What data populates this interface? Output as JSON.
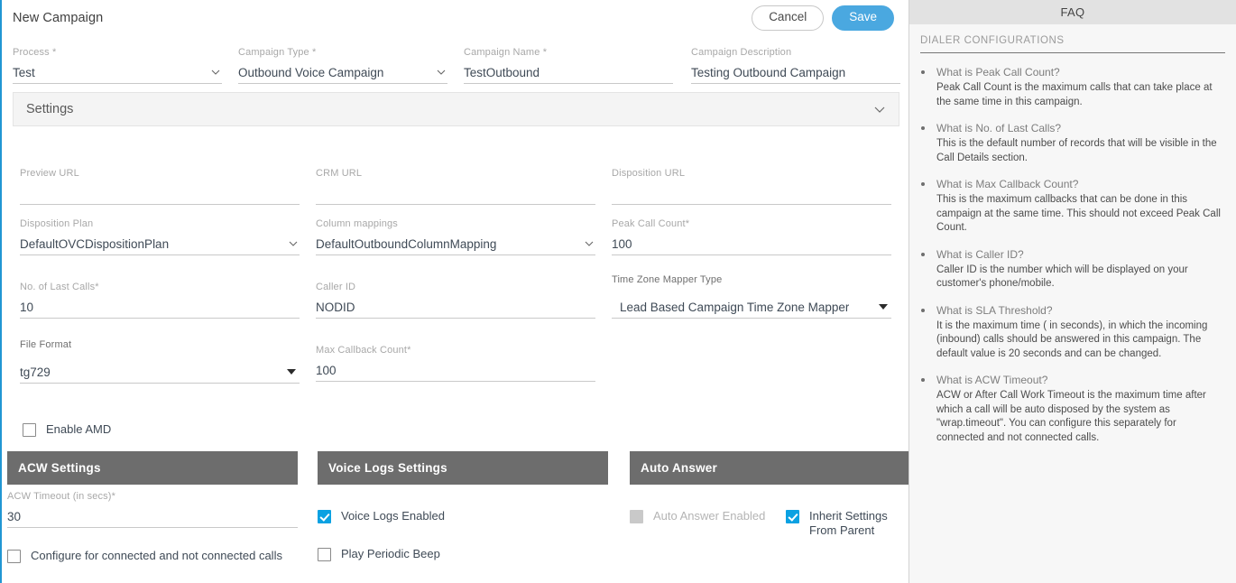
{
  "header": {
    "title": "New Campaign",
    "cancel_label": "Cancel",
    "save_label": "Save",
    "save_color": "#4aa8e0"
  },
  "top_fields": [
    {
      "label": "Process *",
      "value": "Test",
      "control": "select"
    },
    {
      "label": "Campaign Type *",
      "value": "Outbound Voice Campaign",
      "control": "select"
    },
    {
      "label": "Campaign Name *",
      "value": "TestOutbound",
      "control": "text"
    },
    {
      "label": "Campaign Description",
      "value": "Testing Outbound Campaign",
      "control": "text"
    }
  ],
  "settings": {
    "title": "Settings",
    "fields": {
      "preview_url": {
        "label": "Preview URL",
        "value": ""
      },
      "crm_url": {
        "label": "CRM URL",
        "value": ""
      },
      "disposition_url": {
        "label": "Disposition URL",
        "value": ""
      },
      "disposition_plan": {
        "label": "Disposition Plan",
        "value": "DefaultOVCDispositionPlan"
      },
      "column_mappings": {
        "label": "Column mappings",
        "value": "DefaultOutboundColumnMapping"
      },
      "peak_call_count": {
        "label": "Peak Call Count*",
        "value": "100"
      },
      "no_of_last_calls": {
        "label": "No. of Last Calls*",
        "value": "10"
      },
      "caller_id": {
        "label": "Caller ID",
        "value": "NODID"
      },
      "time_zone_mapper_type": {
        "label": "Time Zone Mapper Type",
        "value": "Lead Based Campaign Time Zone Mapper"
      },
      "file_format": {
        "label": "File Format",
        "value": "tg729"
      },
      "max_callback_count": {
        "label": "Max Callback Count*",
        "value": "100"
      }
    },
    "enable_amd": {
      "label": "Enable AMD",
      "checked": false
    }
  },
  "acw": {
    "title": "ACW Settings",
    "timeout": {
      "label": "ACW Timeout (in secs)*",
      "value": "30"
    },
    "configure_connected": {
      "label": "Configure for connected and not connected calls",
      "checked": false
    }
  },
  "voice_logs": {
    "title": "Voice Logs Settings",
    "voice_logs_enabled": {
      "label": "Voice Logs Enabled",
      "checked": true
    },
    "play_periodic_beep": {
      "label": "Play Periodic Beep",
      "checked": false
    }
  },
  "auto_answer": {
    "title": "Auto Answer",
    "auto_answer_enabled": {
      "label": "Auto Answer Enabled",
      "checked": false,
      "disabled": true
    },
    "inherit_from_parent": {
      "label": "Inherit Settings From Parent",
      "checked": true
    }
  },
  "faq": {
    "title": "FAQ",
    "section_title": "DIALER CONFIGURATIONS",
    "items": [
      {
        "question": "What is Peak Call Count?",
        "answer": "Peak Call Count is the maximum calls that can take place at the same time in this campaign."
      },
      {
        "question": "What is No. of Last Calls?",
        "answer": "This is the default number of records that will be visible in the Call Details section."
      },
      {
        "question": "What is Max Callback Count?",
        "answer": "This is the maximum callbacks that can be done in this campaign at the same time. This should not exceed Peak Call Count."
      },
      {
        "question": "What is Caller ID?",
        "answer": "Caller ID is the number which will be displayed on your customer's phone/mobile."
      },
      {
        "question": "What is SLA Threshold?",
        "answer": "It is the maximum time ( in seconds), in which the incoming (inbound) calls should be answered in this campaign. The default value is 20 seconds and can be changed."
      },
      {
        "question": "What is ACW Timeout?",
        "answer": "ACW or After Call Work Timeout is the maximum time after which a call will be auto disposed by the system as \"wrap.timeout\". You can configure this separately for connected and not connected calls."
      }
    ]
  }
}
